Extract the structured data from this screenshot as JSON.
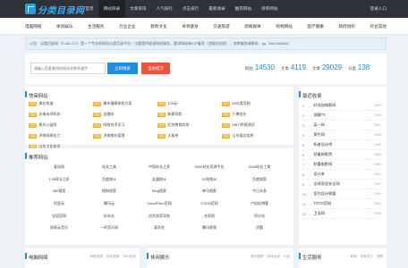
{
  "header": {
    "logo_text": "分类目录网",
    "nav": [
      "首页",
      "网站目录",
      "文章资讯",
      "人气排行",
      "点击排行",
      "最新收录",
      "推荐网站",
      "待审网站"
    ],
    "active_index": 1,
    "login": "登录入口"
  },
  "categories": [
    "电脑网络",
    "休闲娱乐",
    "生活服务",
    "行业企业",
    "教育文化",
    "体育健身",
    "交通旅游",
    "新闻媒体",
    "购物网站",
    "医疗健康",
    "政府组织",
    "综合其他"
  ],
  "notice": "公告：分类目录网（FLML.CC）是一个专业的网站分类目录平台！主要提供收录网站服务，要求网站有ICP备案（违规站勿扰），快审服务请联系：qq（961348984）",
  "search": {
    "placeholder": "请输入您要查找的网站名称关键字",
    "search_button": "立即搜索",
    "submit_button": "自助提交"
  },
  "stats": [
    {
      "label": "网站",
      "value": "14530"
    },
    {
      "label": "文章",
      "value": "4119"
    },
    {
      "label": "文章",
      "value": "29029"
    },
    {
      "label": "分类",
      "value": "138"
    }
  ],
  "quick_sites": {
    "title": "快审网站",
    "tag": "站点",
    "items": [
      "拿在知道",
      "美年健康体检方案",
      "129云",
      "85分类导航",
      "无锡永鸿科技",
      "金融网",
      "新客导航",
      "万博金业",
      "星光公益网",
      "网络技术学习",
      "北京教育科技",
      "MBTI性格测试",
      "济南网络化工",
      "济南物业管理",
      "太极茶",
      "山东饭店信息",
      "山东工业化学"
    ]
  },
  "recommend": {
    "title": "推荐网站",
    "links": [
      "爱站网",
      "站长工具",
      "中国站长之家",
      "3000站长资源平台",
      "5118站长工具",
      "178网址之家",
      "百度统计",
      "友盟统计",
      "51啦统计",
      "百度搜索",
      "360搜索",
      "搜狗搜索",
      "Bing搜索",
      "神马搜索",
      "今日头条",
      "阿里云",
      "腾讯云",
      "CloudFlare官网",
      "CSDN官网",
      "卢松松博客",
      "宝塔官网",
      "好站长",
      "优质卖家导航",
      "名家网",
      "积分站",
      "网易云音乐",
      "一听音乐网",
      "爱奇艺",
      "腾讯视频",
      "优酷"
    ]
  },
  "latest": {
    "title": "最近收录",
    "items": [
      {
        "name": "好选加电影网",
        "count": "1569"
      },
      {
        "name": "湖塘TV",
        "count": "1568"
      },
      {
        "name": "英一网",
        "count": "1567"
      },
      {
        "name": "黄竹网",
        "count": "1566"
      },
      {
        "name": "拓者设计吧",
        "count": "1565"
      },
      {
        "name": "舒童新影院",
        "count": "1564"
      },
      {
        "name": "秋霞电影网",
        "count": "1563"
      },
      {
        "name": "设计本",
        "count": "1562"
      },
      {
        "name": "全球家居安全网",
        "count": "1561"
      },
      {
        "name": "室内设计联盟",
        "count": "1560"
      },
      {
        "name": "TOTO官网",
        "count": "1559"
      },
      {
        "name": "卫浴网",
        "count": "1558"
      }
    ]
  },
  "bottom": [
    {
      "title": "电脑网络",
      "tabs": [
        "网络资源",
        "站长资源",
        "SEO优化"
      ]
    },
    {
      "title": "休闲娱乐",
      "tabs": [
        "音乐视频",
        "游戏动漫",
        "小说"
      ]
    },
    {
      "title": "生活服务",
      "tabs": [
        "美食",
        "衣食住行",
        "宠物"
      ]
    }
  ]
}
